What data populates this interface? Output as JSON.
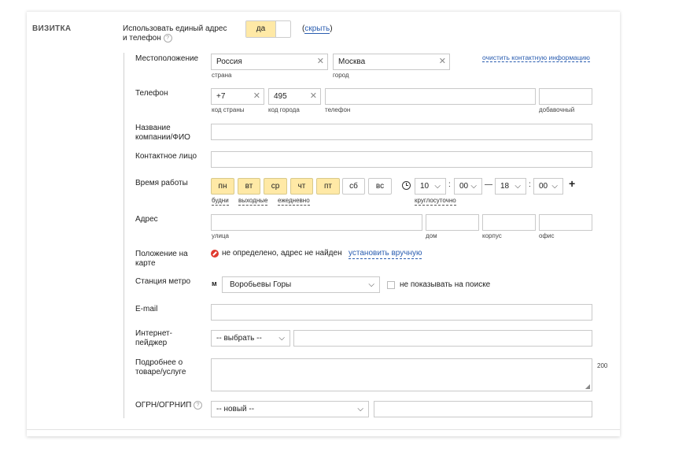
{
  "section_title": "ВИЗИТКА",
  "unified": {
    "label": "Использовать единый адрес и телефон",
    "toggle_on": "да",
    "hide_link": "скрыть"
  },
  "location": {
    "label": "Местоположение",
    "country": "Россия",
    "country_sub": "страна",
    "city": "Москва",
    "city_sub": "город",
    "clear_link": "очистить контактную информацию"
  },
  "phone": {
    "label": "Телефон",
    "country_code": "+7",
    "country_code_sub": "код страны",
    "city_code": "495",
    "city_code_sub": "код города",
    "number": "",
    "number_sub": "телефон",
    "ext": "",
    "ext_sub": "добавочный"
  },
  "company": {
    "label": "Название компании/ФИО",
    "value": ""
  },
  "contact": {
    "label": "Контактное лицо",
    "value": ""
  },
  "hours": {
    "label": "Время работы",
    "days": [
      "пн",
      "вт",
      "ср",
      "чт",
      "пт",
      "сб",
      "вс"
    ],
    "presets": [
      "будни",
      "выходные",
      "ежедневно"
    ],
    "from_h": "10",
    "from_m": "00",
    "dash": "—",
    "to_h": "18",
    "to_m": "00",
    "colon": ":",
    "around_clock": "круглосуточно",
    "add": "+"
  },
  "address": {
    "label": "Адрес",
    "street_sub": "улица",
    "house_sub": "дом",
    "building_sub": "корпус",
    "office_sub": "офис"
  },
  "map": {
    "label": "Положение на карте",
    "status": "не определено, адрес не найден",
    "set_link": "установить вручную"
  },
  "metro": {
    "label": "Станция метро",
    "value": "Воробьевы Горы",
    "hide_label": "не показывать на поиске",
    "icon_letter": "м"
  },
  "email": {
    "label": "E-mail",
    "value": ""
  },
  "pager": {
    "label": "Интернет-пейджер",
    "select": "-- выбрать --",
    "value": ""
  },
  "details": {
    "label": "Подробнее о товаре/услуге",
    "counter": "200"
  },
  "ogrn": {
    "label": "ОГРН/ОГРНИП",
    "select": "-- новый --",
    "value": ""
  }
}
